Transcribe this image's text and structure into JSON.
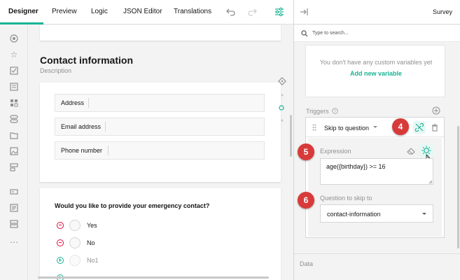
{
  "tabs": [
    {
      "label": "Designer",
      "active": true
    },
    {
      "label": "Preview"
    },
    {
      "label": "Logic"
    },
    {
      "label": "JSON Editor"
    },
    {
      "label": "Translations"
    }
  ],
  "toolbar_icons": [
    "undo-icon",
    "redo-icon",
    "settings-icon"
  ],
  "toolbox_icons": [
    "radio-group-icon",
    "rating-icon",
    "checkbox-icon",
    "comment-icon",
    "matrix-icon",
    "boolean-icon",
    "file-icon",
    "image-icon",
    "multiple-text-icon",
    "text-input-icon",
    "html-icon",
    "panel-icon",
    "more-icon"
  ],
  "page": {
    "title": "Contact information",
    "description": "Description",
    "fields": [
      "Address",
      "Email address",
      "Phone number"
    ]
  },
  "question": {
    "title": "Would you like to provide your emergency contact?",
    "choices": [
      "Yes",
      "No"
    ],
    "new_choice": "No1"
  },
  "panel": {
    "title": "Survey",
    "search_placeholder": "Type to search...",
    "variables_empty": "You don't have any custom variables yet",
    "add_variable": "Add new variable",
    "triggers_label": "Triggers",
    "trigger_name": "Skip to question",
    "expression_label": "Expression",
    "expression_value": "age({birthday}) >= 16",
    "skip_label": "Question to skip to",
    "skip_value": "contact-information",
    "data_label": "Data"
  },
  "callouts": [
    "4",
    "5",
    "6"
  ],
  "colors": {
    "accent": "#19b394",
    "callout": "#d83a3a",
    "remove": "#e50a3e"
  }
}
